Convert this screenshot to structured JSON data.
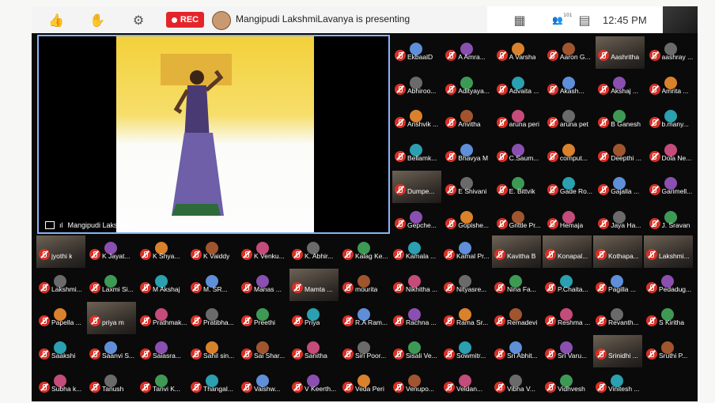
{
  "meeting": {
    "presenting_text": "Mangipudi LakshmiLavanya is presenting",
    "rec_label": "REC",
    "clock": "12:45 PM",
    "share_label": "Mangipudi Lakshmi...",
    "participant_count_badge": "101"
  },
  "colors": {
    "accent": "#8ab4f8",
    "rec": "#e3252b",
    "mute": "#d93025"
  },
  "toolbar": {
    "icons": [
      "thumbs-up-icon",
      "raise-hand-icon",
      "settings-icon",
      "grid-view-icon",
      "people-icon",
      "chat-icon"
    ]
  },
  "right_grid": [
    [
      "EkbaalD",
      "A Amra...",
      "A Varsha",
      "Aaron G...",
      "Aashritha",
      "aashray ..."
    ],
    [
      "Abhiroo...",
      "Adityaya...",
      "Advaita ...",
      "Akash...",
      "Akshaj ...",
      "Amrita ..."
    ],
    [
      "Anshvik ...",
      "Anvitha",
      "aruna peri",
      "aruna pet",
      "B Ganesh",
      "b.many..."
    ],
    [
      "Bellamk...",
      "Bhavya M",
      "C.Saum...",
      "comput...",
      "Deepthi ...",
      "Dola Ne..."
    ],
    [
      "Dumpe...",
      "E Shivani",
      "E. Bittvik",
      "Gade Ro...",
      "Gajalla ...",
      "Garimell..."
    ],
    [
      "Gepche...",
      "Gopishe...",
      "Grittle Pr...",
      "Hemaja",
      "Jaya Ha...",
      "J. Sravan"
    ]
  ],
  "bottom_grid": [
    [
      "jyothi k",
      "K Jayat...",
      "K Shya...",
      "K Vaiddy",
      "K Venku...",
      "K. Abhir...",
      "Kalag Ke...",
      "Kamala ...",
      "Kamal Pr...",
      "Kavitha B",
      "Konapal...",
      "Kothapa...",
      "Lakshmi..."
    ],
    [
      "Lakshmi...",
      "Laxmi Si...",
      "M Akshaj",
      "M. SR...",
      "Manas ...",
      "Mamta ...",
      "mourita",
      "Nikhitha ...",
      "Nityasre...",
      "Nina Fa...",
      "P.Chaita...",
      "Pagilla ...",
      "Pedadug..."
    ],
    [
      "Papella ...",
      "priya m",
      "Prathmak...",
      "Pratibha...",
      "Preethi",
      "Priya",
      "R.A Ram...",
      "Rachna ...",
      "Rama Sr...",
      "Remadevi",
      "Reshma ...",
      "Revanth...",
      "S Kiritha"
    ],
    [
      "Saakshi",
      "Saanvi S...",
      "Saiasra...",
      "Sahil sin...",
      "Sai Shar...",
      "Sanitha",
      "Siri Poor...",
      "Sisali Ve...",
      "Sowmitr...",
      "Sri Abhit...",
      "Sri Varu...",
      "Srinidhi ...",
      "Sruthi P..."
    ],
    [
      "Subha k...",
      "Tanush",
      "Tanvi K...",
      "Thangal...",
      "Vaishw...",
      "V Keerth...",
      "Veda Peri",
      "Venupo...",
      "Veldan...",
      "Vibha V...",
      "Vidhvesh",
      "Vinitesh ...",
      ""
    ]
  ]
}
